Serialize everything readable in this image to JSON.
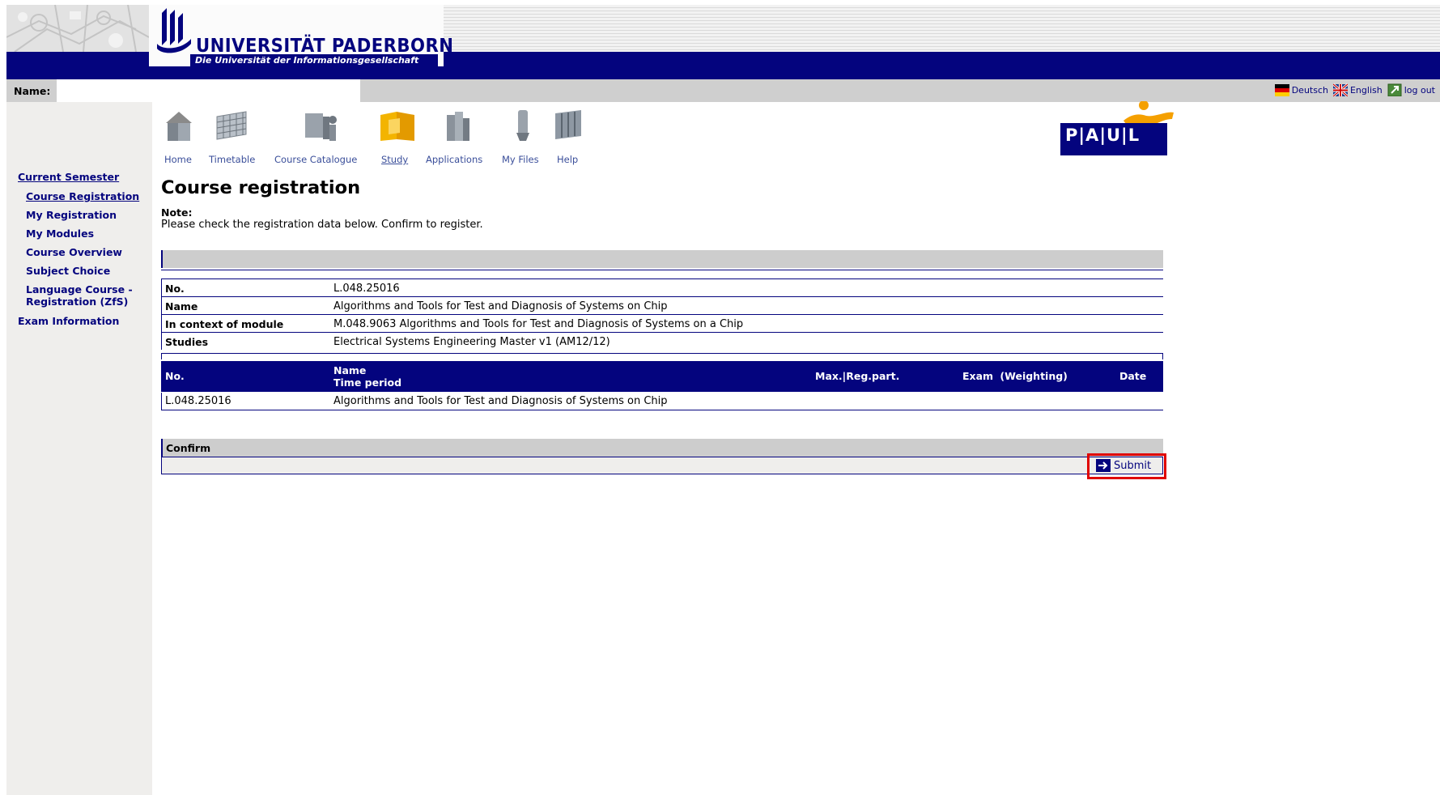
{
  "header": {
    "university_name": "UNIVERSITÄT PADERBORN",
    "tagline": "Die Universität der Informationsgesellschaft"
  },
  "namebar": {
    "label": "Name:",
    "value": "",
    "links": [
      {
        "label": "Deutsch",
        "icon": "german-flag-icon"
      },
      {
        "label": "English",
        "icon": "uk-flag-icon"
      },
      {
        "label": "log out",
        "icon": "logout-icon"
      }
    ]
  },
  "topnav": [
    {
      "label": "Home",
      "icon": "home-icon",
      "active": false
    },
    {
      "label": "Timetable",
      "icon": "timetable-icon",
      "active": false
    },
    {
      "label": "Course Catalogue",
      "icon": "course-catalogue-icon",
      "active": false
    },
    {
      "label": "Study",
      "icon": "study-icon",
      "active": true
    },
    {
      "label": "Applications",
      "icon": "applications-icon",
      "active": false
    },
    {
      "label": "My Files",
      "icon": "my-files-icon",
      "active": false
    },
    {
      "label": "Help",
      "icon": "help-icon",
      "active": false
    }
  ],
  "paul_logo": "P|A|U|L",
  "sidebar": {
    "items": [
      {
        "label": "Current Semester"
      },
      {
        "label": "Course Registration"
      },
      {
        "label": "My Registration"
      },
      {
        "label": "My Modules"
      },
      {
        "label": "Course Overview"
      },
      {
        "label": "Subject Choice"
      },
      {
        "label": "Language Course -"
      },
      {
        "label": "Registration (ZfS)"
      },
      {
        "label": "Exam Information"
      }
    ]
  },
  "page": {
    "title": "Course registration",
    "note_label": "Note:",
    "note_text": "Please check the registration data below. Confirm to register."
  },
  "info": [
    {
      "key": "No.",
      "value": "L.048.25016"
    },
    {
      "key": "Name",
      "value": "Algorithms and Tools for Test and Diagnosis of Systems on Chip"
    },
    {
      "key": "In context of module",
      "value": "M.048.9063 Algorithms and Tools for Test and Diagnosis of Systems on a Chip"
    },
    {
      "key": "Studies",
      "value": "Electrical Systems Engineering Master v1 (AM12/12)"
    }
  ],
  "table": {
    "headers": {
      "no": "No.",
      "name": "Name",
      "time_period": "Time period",
      "max_reg": "Max.|Reg.part.",
      "exam": "Exam (Weighting)",
      "date": "Date"
    },
    "rows": [
      {
        "no": "L.048.25016",
        "name": "Algorithms and Tools for Test and Diagnosis of Systems on Chip"
      }
    ]
  },
  "confirm": {
    "label": "Confirm",
    "submit_label": "Submit"
  },
  "colors": {
    "brand_blue": "#04047e",
    "sidebar_bg": "#efeeec",
    "grey_bar": "#cdcdcd",
    "highlight": "#e00000",
    "paul_orange": "#f5a000"
  }
}
